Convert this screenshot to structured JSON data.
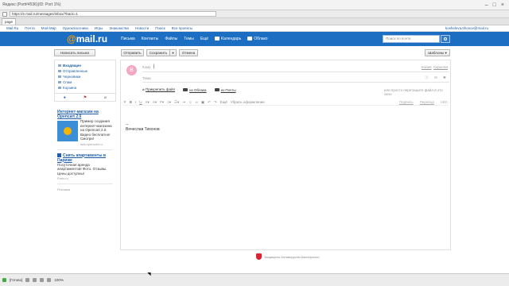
{
  "window": {
    "title": "Яндекс (Port#4536)(ID: Port 1%)",
    "url": "https://e.mail.ru/messages/inbox/?back=1",
    "tab": "page"
  },
  "portal": {
    "links": [
      "Mail.Ru",
      "Почта",
      "Мой Мир",
      "Одноклассники",
      "Игры",
      "Знакомства",
      "Новости",
      "Поиск",
      "Все проекты"
    ],
    "email": "kosheleva.tihonov@mail.ru"
  },
  "header": {
    "logo_at": "@",
    "logo_text": "mail.ru",
    "nav": [
      "Письма",
      "Контакты",
      "Файлы",
      "Темы",
      "Ещё"
    ],
    "calendar": "Календарь",
    "cloud": "Облако",
    "search_placeholder": "Поиск по почте"
  },
  "toolbar": {
    "compose": "Написать письмо",
    "send": "Отправить",
    "save": "Сохранить",
    "cancel": "Отмена",
    "templates": "Шаблоны"
  },
  "sidebar": {
    "folders": [
      "Входящие",
      "Отправленные",
      "Черновики",
      "Спам",
      "Корзина"
    ],
    "ads": [
      {
        "title": "Интернет-магазин на Opencart 2.0",
        "text": "Пример создания интернет-магазина на Opencart 2.0. Видео бесплатно! Смотри!",
        "source": "ads.opencart.ru"
      },
      {
        "title": "Снять апартаменты в Париже",
        "text": "Посуточная аренда апартаментов! Фото. Отзывы. Цены доступны!",
        "source": "Paris.ru"
      }
    ],
    "ad_label": "Реклама"
  },
  "compose": {
    "avatar_letter": "В",
    "to_label": "Кому",
    "copy": "Копия",
    "bcc": "Скрытая",
    "subject_label": "Тема",
    "attach_file": "Прикрепить файл",
    "from_cloud": "из Облака",
    "from_mail": "из Почты",
    "drag_hint": "или просто перетащите файл в это окно",
    "format_more": "Ещё",
    "clear_format": "Убрать оформление",
    "signature": "Подпись",
    "translate": "Перевод",
    "body_sep": "--",
    "body_name": "Вячеслав Тихонов"
  },
  "footer": {
    "text": "Защищено Антивирусом Касперского"
  },
  "statusbar": {
    "status": "[Готово]",
    "zoom": "100%"
  }
}
